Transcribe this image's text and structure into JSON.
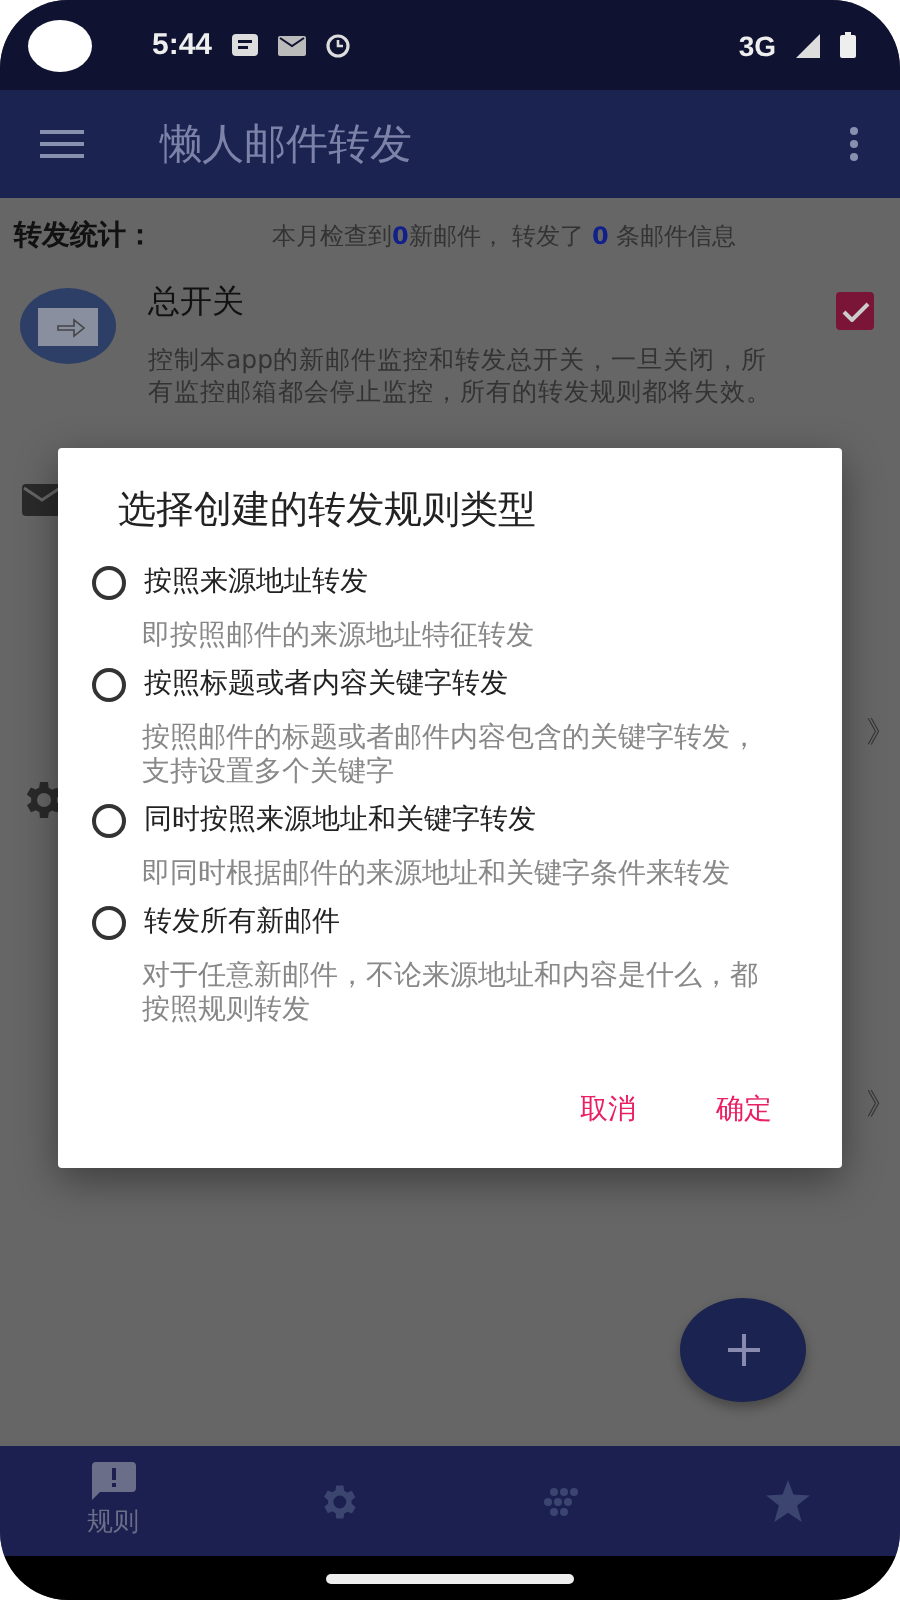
{
  "status_bar": {
    "time": "5:44",
    "network": "3G"
  },
  "app_bar": {
    "title": "懒人邮件转发"
  },
  "stats": {
    "label": "转发统计：",
    "text": "本月检查到**0**新邮件， 转发了 **0** 条邮件信息"
  },
  "master_switch": {
    "title": "总开关",
    "description": "控制本app的新邮件监控和转发总开关，一旦关闭，所有监控邮箱都会停止监控，所有的转发规则都将失效。",
    "checked": true
  },
  "background_rows": [
    {
      "kind": "mail",
      "trailing": "》"
    },
    {
      "kind": "settings",
      "trailing": "》"
    }
  ],
  "dialog": {
    "title": "选择创建的转发规则类型",
    "options": [
      {
        "label": "按照来源地址转发",
        "description": "即按照邮件的来源地址特征转发",
        "selected": false
      },
      {
        "label": "按照标题或者内容关键字转发",
        "description": "按照邮件的标题或者邮件内容包含的关键字转发，支持设置多个关键字",
        "selected": false
      },
      {
        "label": "同时按照来源地址和关键字转发",
        "description": "即同时根据邮件的来源地址和关键字条件来转发",
        "selected": false
      },
      {
        "label": "转发所有新邮件",
        "description": "对于任意新邮件，不论来源地址和内容是什么，都按照规则转发",
        "selected": false
      }
    ],
    "buttons": [
      {
        "label": "取消"
      },
      {
        "label": "确定"
      }
    ]
  },
  "bottom_nav": [
    {
      "kind": "alert",
      "label": "规则",
      "selected": true
    },
    {
      "kind": "settings",
      "selected": false
    },
    {
      "kind": "dots",
      "selected": false
    },
    {
      "kind": "star",
      "selected": false
    }
  ]
}
